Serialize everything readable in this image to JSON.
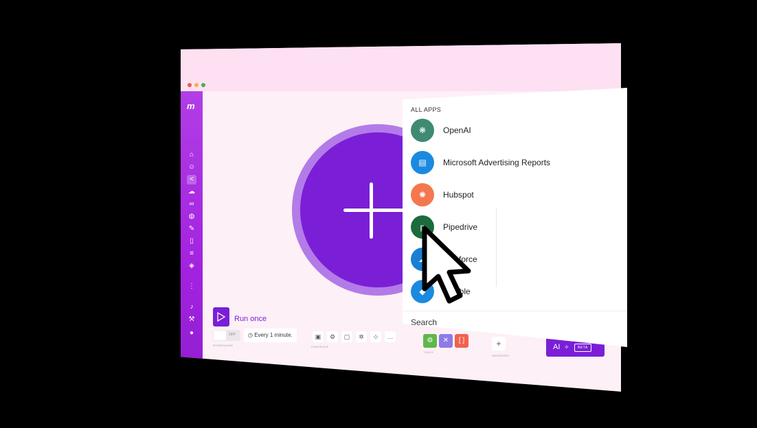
{
  "window_controls": [
    "close",
    "minimize",
    "maximize"
  ],
  "colors": {
    "accent": "#7a1fd6",
    "sidebar": "#a322e0",
    "titlebar": "#fde0f1"
  },
  "sidebar": {
    "logo": "m",
    "icons": [
      "home-icon",
      "users-icon",
      "share-icon",
      "cloud-icon",
      "link-icon",
      "globe-icon",
      "pen-icon",
      "phone-icon",
      "database-icon",
      "cube-icon",
      "more-icon",
      "bell-icon",
      "wrench-icon",
      "avatar"
    ]
  },
  "bottombar": {
    "run_once": "Run once",
    "toggle_state": "OFF",
    "scheduling_label": "SCHEDULING",
    "schedule": "Every 1 minute.",
    "controls_label": "CONTROLS",
    "tools_label": "TOOLS",
    "favorites_label": "FAVORITES",
    "ai_label": "AI",
    "beta_label": "BETA"
  },
  "apps_panel": {
    "title": "ALL APPS",
    "items": [
      {
        "name": "OpenAI",
        "icon": "openai-icon",
        "color": "#3f8a72"
      },
      {
        "name": "Microsoft Advertising Reports",
        "icon": "microsoft-advertising-icon",
        "color": "#1a8ae0"
      },
      {
        "name": "Hubspot",
        "icon": "hubspot-icon",
        "color": "#f5774f"
      },
      {
        "name": "Pipedrive",
        "icon": "pipedrive-icon",
        "color": "#1d6b3c"
      },
      {
        "name": "sforce",
        "icon": "salesforce-icon",
        "color": "#1a7fd4"
      },
      {
        "name": "able",
        "icon": "airtable-icon",
        "color": "#1a8ae0"
      }
    ],
    "search_label": "Search"
  }
}
